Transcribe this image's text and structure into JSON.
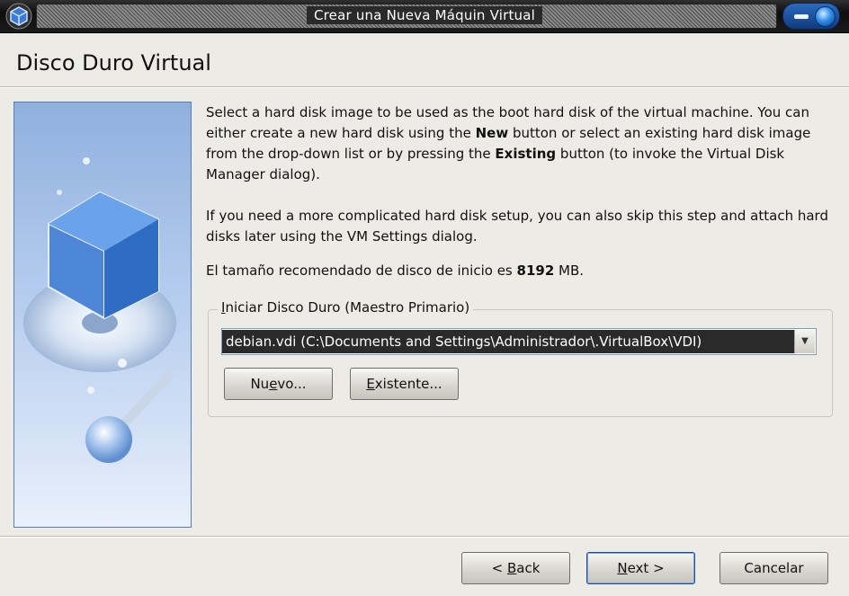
{
  "window": {
    "title": "Crear una Nueva Máquin Virtual"
  },
  "page": {
    "title": "Disco Duro Virtual"
  },
  "description": {
    "p1_a": "Select a hard disk image to be used as the boot hard disk of the virtual machine. You can either create a new hard disk using the ",
    "p1_new": "New",
    "p1_b": " button or select an existing hard disk image from the drop-down list or by pressing the ",
    "p1_existing": "Existing",
    "p1_c": " button (to invoke the Virtual Disk Manager dialog).",
    "p2": "If you need a more complicated hard disk setup, you can also skip this step and attach hard disks later using the VM Settings dialog.",
    "p3_a": "El tamaño recomendado de disco de inicio es ",
    "p3_size": "8192",
    "p3_b": " MB."
  },
  "boot_disk": {
    "legend_prefix": "I",
    "legend_rest": "niciar Disco Duro (Maestro Primario)",
    "selected": "debian.vdi (C:\\Documents and Settings\\Administrador\\.VirtualBox\\VDI)",
    "new_button": {
      "before": "Nu",
      "mnemonic": "e",
      "after": "vo..."
    },
    "existing_button": {
      "mnemonic": "E",
      "after": "xistente..."
    }
  },
  "footer": {
    "back_button": {
      "before": "< ",
      "mnemonic": "B",
      "after": "ack"
    },
    "next_button": {
      "mnemonic": "N",
      "after": "ext >"
    },
    "cancel_label": "Cancelar"
  },
  "icons": [
    "virtualbox-app-icon",
    "minimize-icon",
    "close-icon",
    "virtualbox-cube-illustration",
    "chevron-down-icon"
  ]
}
